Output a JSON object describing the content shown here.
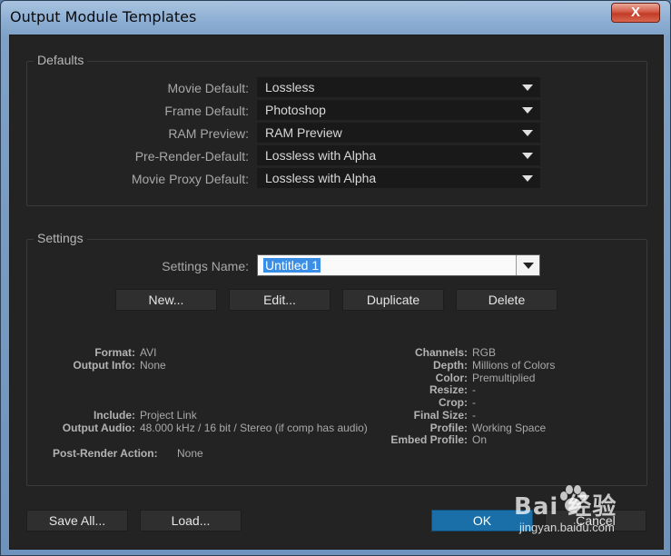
{
  "window": {
    "title": "Output Module Templates",
    "close_label": "X"
  },
  "defaults": {
    "group_label": "Defaults",
    "rows": [
      {
        "label": "Movie Default:",
        "value": "Lossless"
      },
      {
        "label": "Frame Default:",
        "value": "Photoshop"
      },
      {
        "label": "RAM Preview:",
        "value": "RAM Preview"
      },
      {
        "label": "Pre-Render-Default:",
        "value": "Lossless with Alpha"
      },
      {
        "label": "Movie Proxy Default:",
        "value": "Lossless with Alpha"
      }
    ]
  },
  "settings": {
    "group_label": "Settings",
    "name_label": "Settings Name:",
    "name_value": "Untitled 1",
    "buttons": {
      "new": "New...",
      "edit": "Edit...",
      "duplicate": "Duplicate",
      "delete": "Delete"
    },
    "info_left": [
      {
        "label": "Format:",
        "value": "AVI"
      },
      {
        "label": "Output Info:",
        "value": "None"
      },
      {
        "label": "Include:",
        "value": "Project Link"
      },
      {
        "label": "Output Audio:",
        "value": "48.000 kHz / 16 bit / Stereo (if comp has audio)"
      }
    ],
    "post_render_label": "Post-Render Action:",
    "post_render_value": "None",
    "info_right": [
      {
        "label": "Channels:",
        "value": "RGB"
      },
      {
        "label": "Depth:",
        "value": "Millions of Colors"
      },
      {
        "label": "Color:",
        "value": "Premultiplied"
      },
      {
        "label": "Resize:",
        "value": "-"
      },
      {
        "label": "Crop:",
        "value": "-"
      },
      {
        "label": "Final Size:",
        "value": "-"
      },
      {
        "label": "Profile:",
        "value": "Working Space"
      },
      {
        "label": "Embed Profile:",
        "value": "On"
      }
    ]
  },
  "footer": {
    "save_all": "Save All...",
    "load": "Load...",
    "ok": "OK",
    "cancel": "Cancel"
  },
  "watermark": {
    "logo": "Bai 经验",
    "url": "jingyan.baidu.com"
  },
  "colors": {
    "accent": "#1a6fa8",
    "panel": "#232323",
    "selection": "#3a8ee6"
  }
}
